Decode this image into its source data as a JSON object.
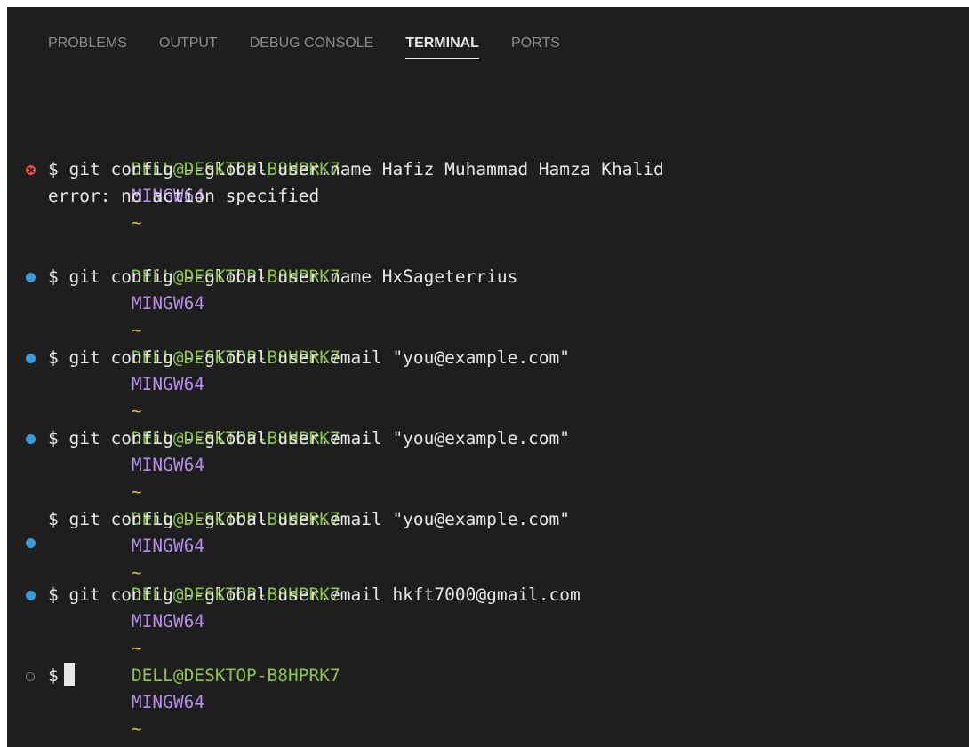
{
  "panel": {
    "tabs": [
      {
        "label": "PROBLEMS",
        "active": false
      },
      {
        "label": "OUTPUT",
        "active": false
      },
      {
        "label": "DEBUG CONSOLE",
        "active": false
      },
      {
        "label": "TERMINAL",
        "active": true
      },
      {
        "label": "PORTS",
        "active": false
      }
    ]
  },
  "terminal": {
    "prompt_user": "DELL@DESKTOP-B8HPRK7",
    "prompt_env": "MINGW64",
    "prompt_path": "~",
    "prompt_symbol": "$",
    "entries": [
      {
        "command": "git config --global user.name Hafiz Muhammad Hamza Khalid",
        "status": "error",
        "output": "error: no action specified"
      },
      {
        "command": "git config --global user.name HxSageterrius",
        "status": "success"
      },
      {
        "command": "git config --global user.email \"you@example.com\"",
        "status": "success"
      },
      {
        "command": "git config --global user.email \"you@example.com\"",
        "status": "success"
      },
      {
        "command": "git config --global user.email \"you@example.com\"",
        "status": "success"
      },
      {
        "command": "git config --global user.email hkft7000@gmail.com",
        "status": "success"
      },
      {
        "command": "",
        "status": "pending"
      }
    ]
  },
  "colors": {
    "background": "#1e1e1e",
    "prompt_user": "#8cc34a",
    "prompt_env": "#b48ee8",
    "prompt_path": "#d6b84e",
    "decoration_success": "#3a9ad9",
    "decoration_error": "#e8504f"
  },
  "icons": {
    "error": "error-circle-icon",
    "success": "success-dot-icon",
    "pending": "empty-circle-icon"
  }
}
